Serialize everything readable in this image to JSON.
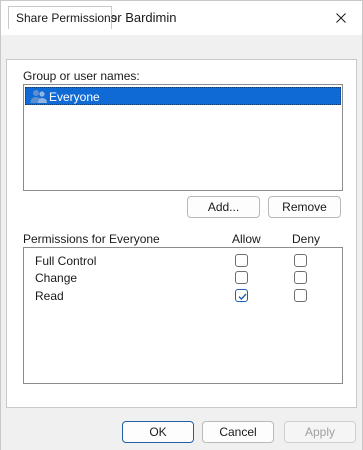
{
  "window": {
    "title": "Permissions for Bardimin"
  },
  "tabs": [
    {
      "label": "Share Permissions",
      "active": true
    }
  ],
  "group_section": {
    "label": "Group or user names:",
    "users": [
      {
        "name": "Everyone",
        "selected": true,
        "icon": "users-icon"
      }
    ]
  },
  "user_buttons": {
    "add_label": "Add...",
    "remove_label": "Remove"
  },
  "permissions": {
    "header": "Permissions for Everyone",
    "allow_header": "Allow",
    "deny_header": "Deny",
    "rows": [
      {
        "name": "Full Control",
        "allow": false,
        "deny": false
      },
      {
        "name": "Change",
        "allow": false,
        "deny": false
      },
      {
        "name": "Read",
        "allow": true,
        "deny": false
      }
    ]
  },
  "footer": {
    "ok_label": "OK",
    "cancel_label": "Cancel",
    "apply_label": "Apply",
    "apply_enabled": false
  },
  "colors": {
    "selection": "#0f6ad6",
    "accent": "#1f5fae",
    "folder": "#f4c54a"
  }
}
